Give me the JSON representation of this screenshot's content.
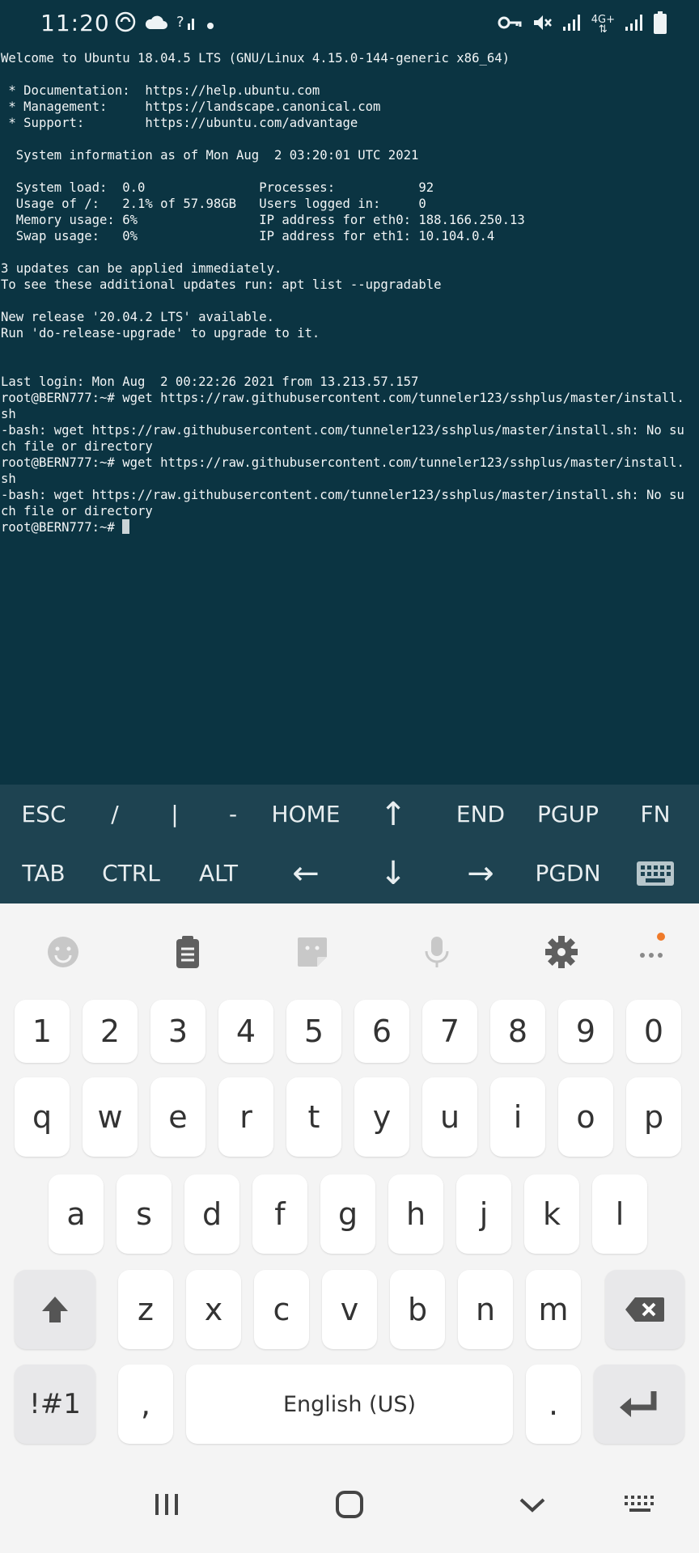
{
  "status": {
    "time": "11:20",
    "network_label": "4G+",
    "left_icons": [
      "spiral-app-icon",
      "cloud-icon",
      "signal-unknown-icon",
      "dot-icon"
    ],
    "right_icons": [
      "vpn-key-icon",
      "mute-icon",
      "signal-icon",
      "network-4g-icon",
      "signal-icon-2",
      "battery-icon"
    ]
  },
  "terminal": {
    "lines": [
      "Welcome to Ubuntu 18.04.5 LTS (GNU/Linux 4.15.0-144-generic x86_64)",
      "",
      " * Documentation:  https://help.ubuntu.com",
      " * Management:     https://landscape.canonical.com",
      " * Support:        https://ubuntu.com/advantage",
      "",
      "  System information as of Mon Aug  2 03:20:01 UTC 2021",
      "",
      "  System load:  0.0               Processes:           92",
      "  Usage of /:   2.1% of 57.98GB   Users logged in:     0",
      "  Memory usage: 6%                IP address for eth0: 188.166.250.13",
      "  Swap usage:   0%                IP address for eth1: 10.104.0.4",
      "",
      "3 updates can be applied immediately.",
      "To see these additional updates run: apt list --upgradable",
      "",
      "New release '20.04.2 LTS' available.",
      "Run 'do-release-upgrade' to upgrade to it.",
      "",
      "",
      "Last login: Mon Aug  2 00:22:26 2021 from 13.213.57.157",
      "root@BERN777:~# wget https://raw.githubusercontent.com/tunneler123/sshplus/master/install.",
      "sh",
      "-bash: wget https://raw.githubusercontent.com/tunneler123/sshplus/master/install.sh: No su",
      "ch file or directory",
      "root@BERN777:~# wget https://raw.githubusercontent.com/tunneler123/sshplus/master/install.",
      "sh",
      "-bash: wget https://raw.githubusercontent.com/tunneler123/sshplus/master/install.sh: No su",
      "ch file or directory"
    ],
    "prompt": "root@BERN777:~# "
  },
  "extra_keys": {
    "row1": [
      "ESC",
      "/",
      "|",
      "-",
      "HOME",
      "↑",
      "END",
      "PGUP",
      "FN"
    ],
    "row2": [
      "TAB",
      "CTRL",
      "ALT",
      "←",
      "↓",
      "→",
      "PGDN"
    ]
  },
  "keyboard": {
    "toolbar_icons": [
      "emoji-icon",
      "clipboard-icon",
      "sticker-icon",
      "microphone-icon",
      "settings-icon",
      "more-icon"
    ],
    "numbers": [
      "1",
      "2",
      "3",
      "4",
      "5",
      "6",
      "7",
      "8",
      "9",
      "0"
    ],
    "row1": [
      "q",
      "w",
      "e",
      "r",
      "t",
      "y",
      "u",
      "i",
      "o",
      "p"
    ],
    "row2": [
      "a",
      "s",
      "d",
      "f",
      "g",
      "h",
      "j",
      "k",
      "l"
    ],
    "row3": [
      "z",
      "x",
      "c",
      "v",
      "b",
      "n",
      "m"
    ],
    "symbols_label": "!#1",
    "comma": ",",
    "space_label": "English (US)",
    "period": "."
  },
  "navbar": {
    "icons": [
      "recent-apps-icon",
      "home-icon",
      "back-icon",
      "keyboard-switch-icon"
    ]
  }
}
